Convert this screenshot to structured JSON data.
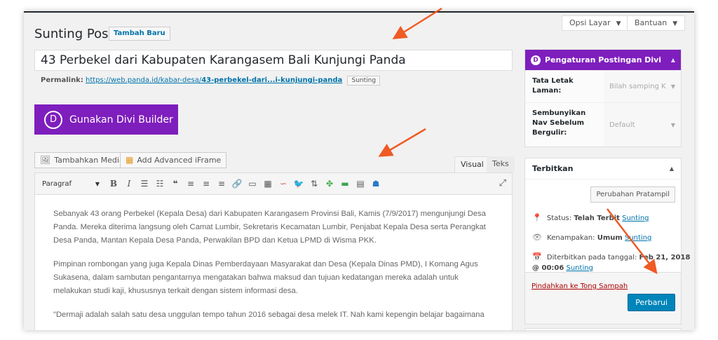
{
  "header": {
    "page_title": "Sunting Pos",
    "add_new_label": "Tambah Baru",
    "screen_options_label": "Opsi Layar",
    "help_label": "Bantuan"
  },
  "post": {
    "title": "43 Perbekel dari Kabupaten Karangasem Bali Kunjungi Panda",
    "permalink_label": "Permalink:",
    "permalink_base": "https://web.panda.id/kabar-desa/",
    "permalink_slug": "43-perbekel-dari...i-kunjungi-panda",
    "permalink_edit_label": "Sunting"
  },
  "divi": {
    "builder_label": "Gunakan Divi Builder",
    "logo": "D"
  },
  "editor": {
    "add_media_label": "Tambahkan Media",
    "add_iframe_label": "Add Advanced iFrame",
    "tab_visual": "Visual",
    "tab_text": "Teks",
    "format_select": "Paragraf",
    "paragraphs": [
      "Sebanyak 43 orang Perbekel (Kepala Desa) dari Kabupaten Karangasem Provinsi Bali, Kamis (7/9/2017) mengunjungi Desa Panda. Mereka diterima langsung oleh Camat Lumbir, Sekretaris Kecamatan Lumbir, Penjabat Kepala Desa serta Perangkat Desa Panda, Mantan Kepala Desa Panda, Perwakilan BPD dan Ketua LPMD di Wisma PKK.",
      "Pimpinan rombongan yang juga Kepala Dinas Pemberdayaan Masyarakat dan Desa (Kepala Dinas PMD), I Komang Agus Sukasena, dalam sambutan pengantarnya mengatakan bahwa maksud dan tujuan kedatangan mereka adalah untuk melakukan studi kaji, khususnya terkait dengan sistem informasi desa.",
      "\"Dermaji adalah salah satu desa unggulan tempo tahun 2016 sebagai desa melek IT. Nah kami kepengin belajar bagaimana"
    ]
  },
  "divi_settings": {
    "title": "Pengaturan Postingan Divi",
    "rows": [
      {
        "label": "Tata Letak Laman:",
        "value": "Bilah samping K"
      },
      {
        "label": "Sembunyikan Nav Sebelum Bergulir:",
        "value": "Default"
      }
    ]
  },
  "publish": {
    "title": "Terbitkan",
    "preview_label": "Perubahan Pratampil",
    "status_label": "Status:",
    "status_value": "Telah Terbit",
    "visibility_label": "Kenampakan:",
    "visibility_value": "Umum",
    "date_label": "Diterbitkan pada tanggal:",
    "date_value": "Feb 21, 2018",
    "time_value": "@ 00:06",
    "edit_label": "Sunting",
    "trash_label": "Pindahkan ke Tong Sampah",
    "update_label": "Perbarui"
  },
  "colors": {
    "divi_purple": "#7e1ebd",
    "primary_blue": "#0085ba",
    "link_blue": "#0073aa",
    "annotation_arrow": "#f05a24"
  }
}
